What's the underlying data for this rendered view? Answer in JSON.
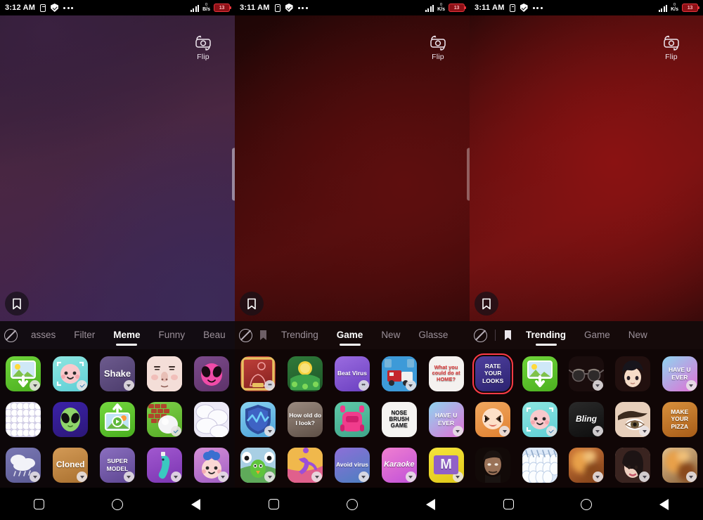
{
  "panels": [
    {
      "id": "panel-left",
      "status": {
        "time": "3:12 AM",
        "battery": "13",
        "data_rate_unit": "B/s",
        "data_rate_value": "0"
      },
      "flip": {
        "label": "Flip",
        "icon": "camera-flip-icon"
      },
      "bookmark_icon": "bookmark-icon",
      "tabbar": {
        "left_icons": [
          "no-effect-icon"
        ],
        "tabs": [
          {
            "label": "asses",
            "active": false
          },
          {
            "label": "Filter",
            "active": false
          },
          {
            "label": "Meme",
            "active": true
          },
          {
            "label": "Funny",
            "active": false
          },
          {
            "label": "Beau",
            "active": false
          }
        ]
      },
      "effects": [
        {
          "name": "gallery-download",
          "label": "",
          "badge": "download",
          "bg": "linear-gradient(160deg,#6fd43a,#4cb020)",
          "art": "photo"
        },
        {
          "name": "cute-face-cyan",
          "label": "",
          "badge": "check",
          "bg": "linear-gradient(160deg,#8de6e0,#5fcfd6)",
          "art": "face-pink"
        },
        {
          "name": "shake",
          "label": "Shake",
          "badge": "download",
          "bg": "linear-gradient(150deg,#6d5b8e,#4b3b6b)",
          "art": "text"
        },
        {
          "name": "pale-face",
          "label": "",
          "badge": "none",
          "bg": "linear-gradient(160deg,#f6e2de,#e9c9c4)",
          "art": "noface"
        },
        {
          "name": "pink-alien",
          "label": "",
          "badge": "none",
          "bg": "linear-gradient(155deg,#7d4b8c,#5d3269)",
          "art": "alien-pink"
        },
        {
          "name": "bubbles-lavender",
          "label": "",
          "badge": "none",
          "bg": "linear-gradient(160deg,#e7e4f3,#cdc9e6)",
          "art": "bubbles"
        },
        {
          "name": "green-alien",
          "label": "",
          "badge": "none",
          "bg": "linear-gradient(160deg,#3b22a8,#2c1778)",
          "art": "alien-green"
        },
        {
          "name": "video-upload",
          "label": "",
          "badge": "none",
          "bg": "linear-gradient(160deg,#74d83f,#49ae1f)",
          "art": "video"
        },
        {
          "name": "brick-balloon",
          "label": "",
          "badge": "check",
          "bg": "linear-gradient(160deg,#7ed04a,#55ab25)",
          "art": "brick"
        },
        {
          "name": "white-blobs",
          "label": "",
          "badge": "none",
          "bg": "linear-gradient(160deg,#efeff6,#d6d4e6)",
          "art": "blobs"
        },
        {
          "name": "rain-clouds",
          "label": "",
          "badge": "download",
          "bg": "linear-gradient(160deg,#7a78b4,#5b5a94)",
          "art": "clouds"
        },
        {
          "name": "cloned",
          "label": "Cloned",
          "badge": "download",
          "bg": "linear-gradient(160deg,#d39a56,#a9702f)",
          "art": "text"
        },
        {
          "name": "super-model",
          "label": "SUPER MODEL",
          "badge": "download",
          "bg": "linear-gradient(155deg,#8b6fc0,#5c4590)",
          "art": "text"
        },
        {
          "name": "purple-bird",
          "label": "",
          "badge": "download",
          "bg": "linear-gradient(160deg,#a158cf,#7b35b2)",
          "art": "bird"
        },
        {
          "name": "galaxy-baby",
          "label": "",
          "badge": "download",
          "bg": "linear-gradient(160deg,#d58fd6,#a05ec4)",
          "art": "baby"
        }
      ]
    },
    {
      "id": "panel-middle",
      "status": {
        "time": "3:11 AM",
        "battery": "13",
        "data_rate_unit": "K/s",
        "data_rate_value": "0"
      },
      "flip": {
        "label": "Flip",
        "icon": "camera-flip-icon"
      },
      "bookmark_icon": "bookmark-icon",
      "tabbar": {
        "left_icons": [
          "no-effect-icon",
          "bookmark-icon"
        ],
        "tabs": [
          {
            "label": "Trending",
            "active": false
          },
          {
            "label": "Game",
            "active": true
          },
          {
            "label": "New",
            "active": false
          },
          {
            "label": "Glasse",
            "active": false
          }
        ]
      },
      "effects": [
        {
          "name": "red-gold-frame",
          "label": "",
          "badge": "face",
          "bg": "linear-gradient(160deg,#c4423c,#7d1d1c)",
          "art": "frame"
        },
        {
          "name": "gold-coin-clover",
          "label": "",
          "badge": "none",
          "bg": "linear-gradient(160deg,#2f7a3a,#1d5527)",
          "art": "coin"
        },
        {
          "name": "beat-virus",
          "label": "Beat Virus",
          "badge": "face",
          "bg": "linear-gradient(155deg,#9b6ce0,#6a3fc0)",
          "art": "text"
        },
        {
          "name": "blue-truck",
          "label": "",
          "badge": "download",
          "bg": "linear-gradient(160deg,#3d9ad8,#1f6fae)",
          "art": "truck"
        },
        {
          "name": "what-you-could-do-at-home",
          "label": "What you could do at HOME?",
          "badge": "none",
          "bg": "#f4f1ef",
          "art": "text-red"
        },
        {
          "name": "blue-shield",
          "label": "",
          "badge": "download",
          "bg": "linear-gradient(160deg,#8ad4f2,#4ba0d8)",
          "art": "shield"
        },
        {
          "name": "how-old-do-i-look",
          "label": "How old do I look?",
          "badge": "none",
          "bg": "linear-gradient(160deg,#9b8b80,#5e4f46)",
          "art": "text"
        },
        {
          "name": "pink-car",
          "label": "",
          "badge": "none",
          "bg": "linear-gradient(160deg,#5fc9a8,#3fa58a)",
          "art": "car"
        },
        {
          "name": "nose-brush-game",
          "label": "NOSE BRUSH GAME",
          "badge": "none",
          "bg": "#f6f4f2",
          "art": "text-black"
        },
        {
          "name": "have-u-ever",
          "label": "HAVE U EVER",
          "badge": "download",
          "bg": "linear-gradient(140deg,#8fd5f0,#e06fd4)",
          "art": "text"
        },
        {
          "name": "bird-eyes",
          "label": "",
          "badge": "download",
          "bg": "linear-gradient(160deg,#a8d4e8,#5fa36b)",
          "art": "birdface"
        },
        {
          "name": "running-figure",
          "label": "",
          "badge": "download",
          "bg": "linear-gradient(150deg,#f0c95c,#e0608c)",
          "art": "runner"
        },
        {
          "name": "avoid-virus",
          "label": "Avoid virus",
          "badge": "download",
          "bg": "linear-gradient(155deg,#8d6fd8,#4b7fc0)",
          "art": "text"
        },
        {
          "name": "karaoke",
          "label": "Karaoke",
          "badge": "download",
          "bg": "linear-gradient(150deg,#f07fd0,#c050d8)",
          "art": "text"
        },
        {
          "name": "yellow-m",
          "label": "M",
          "badge": "download",
          "bg": "linear-gradient(160deg,#f5e43c,#e0c818)",
          "art": "text-m"
        }
      ]
    },
    {
      "id": "panel-right",
      "status": {
        "time": "3:11 AM",
        "battery": "13",
        "data_rate_unit": "K/s",
        "data_rate_value": "0"
      },
      "flip": {
        "label": "Flip",
        "icon": "camera-flip-icon"
      },
      "bookmark_icon": "bookmark-icon",
      "tabbar": {
        "left_icons": [
          "no-effect-icon",
          "bookmark-icon-filled"
        ],
        "tabs": [
          {
            "label": "Trending",
            "active": true
          },
          {
            "label": "Game",
            "active": false
          },
          {
            "label": "New",
            "active": false
          }
        ]
      },
      "effects": [
        {
          "name": "rate-your-looks",
          "label": "RATE YOUR LOOKS",
          "badge": "none",
          "bg": "linear-gradient(160deg,#4e3f9e,#2c2370)",
          "art": "text",
          "selected": true
        },
        {
          "name": "gallery-download",
          "label": "",
          "badge": "none",
          "bg": "linear-gradient(160deg,#6fd43a,#4cb020)",
          "art": "photo"
        },
        {
          "name": "sunglasses",
          "label": "",
          "badge": "download",
          "bg": "#1a0d0d",
          "art": "glasses"
        },
        {
          "name": "anime-face",
          "label": "",
          "badge": "none",
          "bg": "#22100f",
          "art": "anime"
        },
        {
          "name": "have-u-ever",
          "label": "HAVE U EVER",
          "badge": "download",
          "bg": "linear-gradient(140deg,#8fd5f0,#e06fd4)",
          "art": "text"
        },
        {
          "name": "orange-face",
          "label": "",
          "badge": "download",
          "bg": "linear-gradient(160deg,#f0a860,#e08030)",
          "art": "face-x"
        },
        {
          "name": "cute-face-cyan",
          "label": "",
          "badge": "check",
          "bg": "linear-gradient(160deg,#8de6e0,#5fcfd6)",
          "art": "face-pink"
        },
        {
          "name": "bling",
          "label": "Bling",
          "badge": "download",
          "bg": "linear-gradient(160deg,#2a2a2a,#0d0d0d)",
          "art": "text-bling"
        },
        {
          "name": "eyebrow",
          "label": "",
          "badge": "download",
          "bg": "linear-gradient(160deg,#e8d0bc,#c8a890)",
          "art": "eye"
        },
        {
          "name": "make-your-pizza",
          "label": "MAKE YOUR PIZZA",
          "badge": "none",
          "bg": "linear-gradient(160deg,#d8903c,#a85c18)",
          "art": "text"
        },
        {
          "name": "bearded-man",
          "label": "",
          "badge": "none",
          "bg": "#140a08",
          "art": "portrait-dark"
        },
        {
          "name": "white-feathers",
          "label": "",
          "badge": "none",
          "bg": "linear-gradient(160deg,#cdd8f0,#eef4fa)",
          "art": "feathers"
        },
        {
          "name": "warm-blur",
          "label": "",
          "badge": "download",
          "bg": "linear-gradient(150deg,#d07838,#7a3c18)",
          "art": "blur"
        },
        {
          "name": "woman-portrait",
          "label": "",
          "badge": "download",
          "bg": "linear-gradient(160deg,#e0c0b0,#6a4038)",
          "art": "portrait"
        },
        {
          "name": "golden-blur",
          "label": "",
          "badge": "download",
          "bg": "linear-gradient(150deg,#e0c090,#8a6038)",
          "art": "blur"
        }
      ]
    }
  ],
  "navbar": {
    "recents": "recents-square-icon",
    "home": "home-circle-icon",
    "back": "back-triangle-icon"
  }
}
